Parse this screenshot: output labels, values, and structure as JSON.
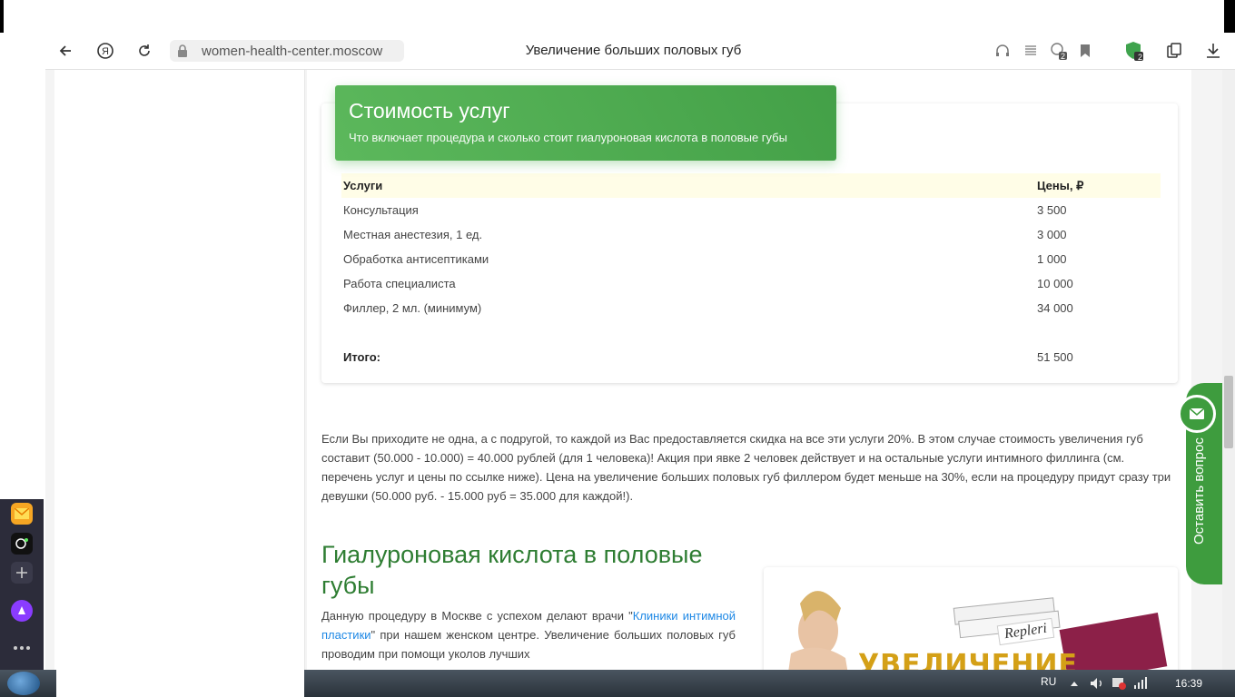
{
  "browser": {
    "url": "women-health-center.moscow",
    "tab_title": "Увеличение больших половых губ",
    "badge_count_1": "2",
    "badge_count_2": "2"
  },
  "price_card": {
    "title": "Стоимость услуг",
    "subtitle": "Что включает процедура и сколько стоит гиалуроновая кислота в половые губы",
    "columns": [
      "Услуги",
      "Цены, ₽"
    ],
    "rows": [
      {
        "service": "Консультация",
        "price": "3 500"
      },
      {
        "service": "Местная анестезия, 1 ед.",
        "price": "3 000"
      },
      {
        "service": "Обработка антисептиками",
        "price": "1 000"
      },
      {
        "service": "Работа специалиста",
        "price": "10 000"
      },
      {
        "service": "Филлер, 2 мл. (минимум)",
        "price": "34 000"
      }
    ],
    "total_label": "Итого:",
    "total_value": "51 500"
  },
  "discount_paragraph": "Если Вы приходите не одна, а с подругой, то каждой из Вас предоставляется скидка на все эти услуги 20%. В этом случае стоимость увеличения губ составит (50.000 - 10.000) = 40.000 рублей (для 1 человека)! Акция при явке 2 человек действует и на остальные услуги интимного филлинга (см. перечень услуг и цены по ссылке ниже). Цена на увеличение больших половых губ филлером будет меньше на 30%, если на процедуру придут сразу три  девушки (50.000 руб. - 15.000 руб = 35.000 для каждой!).",
  "section": {
    "heading": "Гиалуроновая кислота в половые губы",
    "text_before": "Данную процедуру в Москве с успехом делают врачи \"",
    "link": "Клиники интимной пластики",
    "text_after": "\" при нашем женском центре. Увеличение больших половых губ проводим при помощи уколов лучших"
  },
  "promo": {
    "word": "УВЕЛИЧЕНИЕ",
    "brand": "Repleri"
  },
  "feedback": {
    "label": "Оставить вопрос"
  },
  "taskbar": {
    "language": "RU",
    "time": "16:39"
  },
  "colors": {
    "accent_green": "#4caf50",
    "heading_green": "#2e7d32",
    "link_blue": "#1e88e5"
  }
}
